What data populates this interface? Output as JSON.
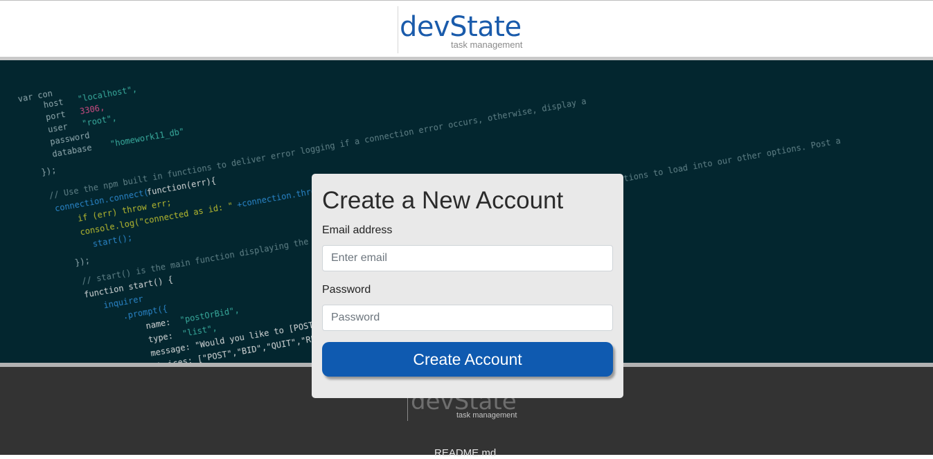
{
  "brand": {
    "name": "devState",
    "tagline": "task management"
  },
  "form": {
    "title": "Create a New Account",
    "email_label": "Email address",
    "email_placeholder": "Enter email",
    "password_label": "Password",
    "password_placeholder": "Password",
    "submit_label": "Create Account"
  },
  "footer": {
    "brand_name": "devState",
    "brand_tagline": "task management",
    "readme_link": "README.md"
  },
  "colors": {
    "brand_blue": "#1a5bab",
    "button_blue": "#0f5ab0",
    "hero_bg": "#03262f",
    "footer_bg": "#333333",
    "card_bg": "#e9e9e9"
  },
  "hero_icon": "code-background-image"
}
